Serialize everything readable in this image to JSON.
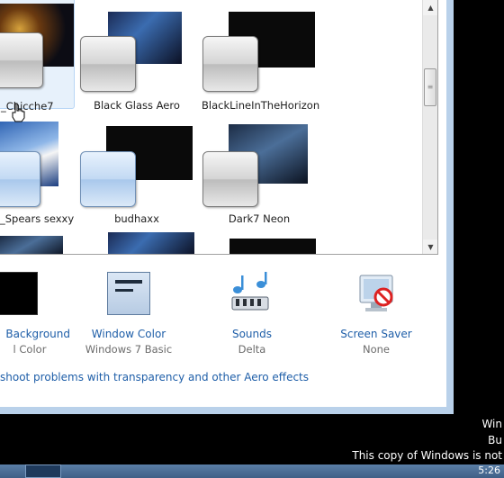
{
  "themes": [
    {
      "label": "_Chicche7"
    },
    {
      "label": "Black Glass Aero"
    },
    {
      "label": "BlackLineInTheHorizon"
    },
    {
      "label": "_Spears sexxy"
    },
    {
      "label": "budhaxx"
    },
    {
      "label": "Dark7 Neon"
    }
  ],
  "options": {
    "background": {
      "title": "Background",
      "sub": "l Color"
    },
    "window_color": {
      "title": "Window Color",
      "sub": "Windows 7 Basic"
    },
    "sounds": {
      "title": "Sounds",
      "sub": "Delta"
    },
    "screen_saver": {
      "title": "Screen Saver",
      "sub": "None"
    }
  },
  "troubleshoot_link": "shoot problems with transparency and other Aero effects",
  "watermark": {
    "line1": "Win",
    "line2": "Bu",
    "line3": "This copy of Windows is not"
  },
  "clock": "5:26",
  "colors": {
    "link": "#1e5ea8",
    "selected_tile": "#e7f1fb"
  }
}
